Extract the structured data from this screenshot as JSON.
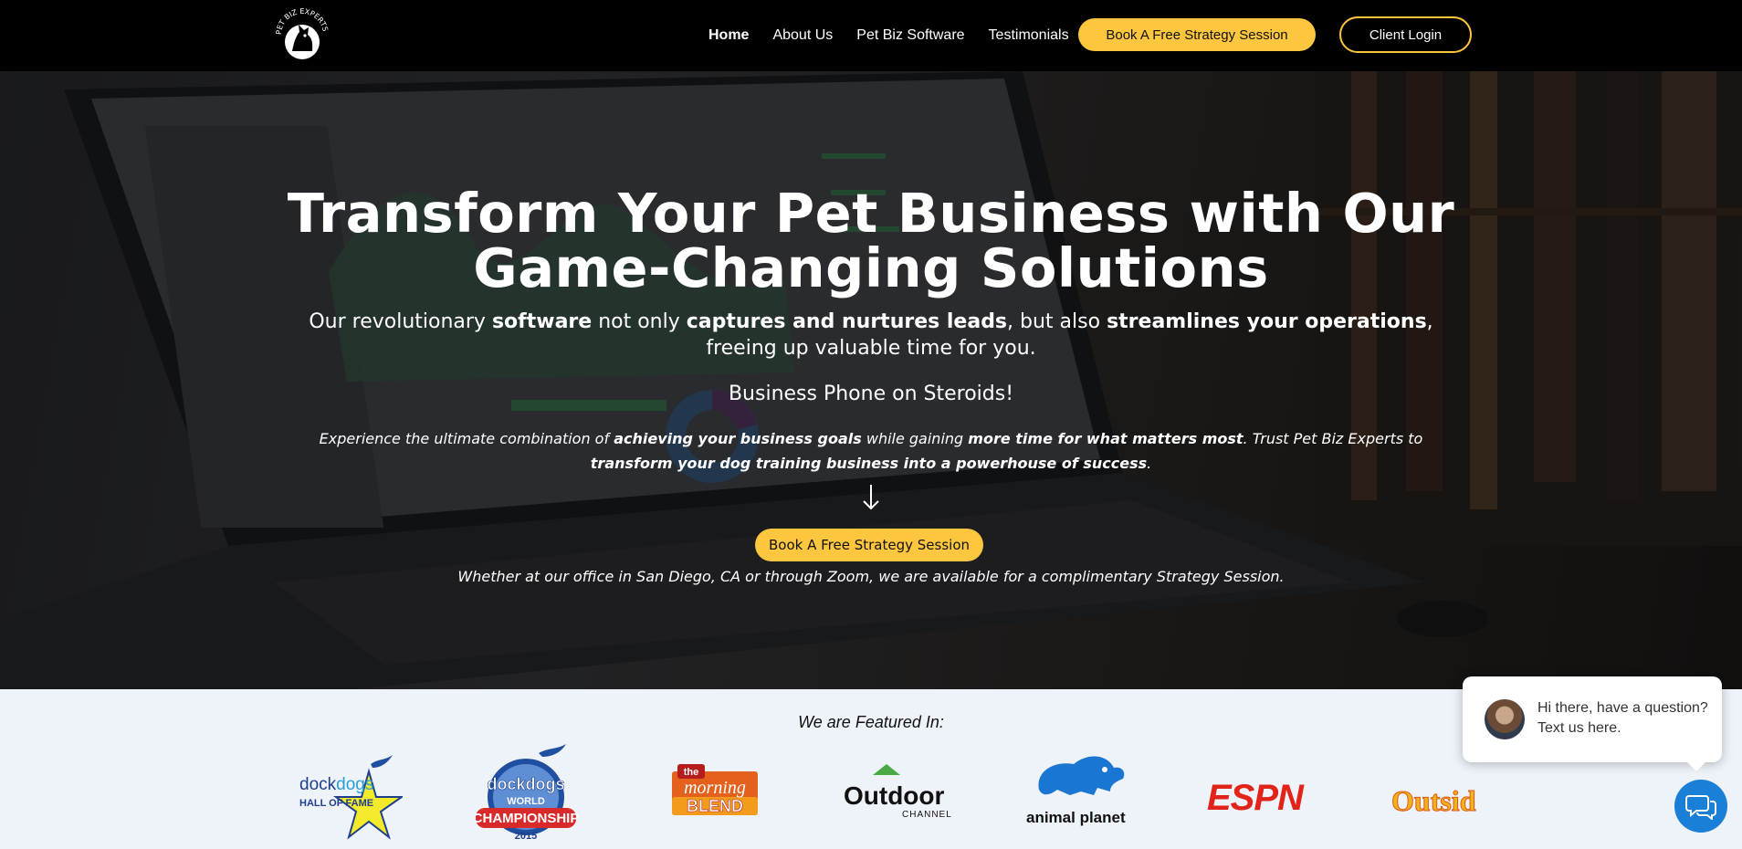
{
  "nav": {
    "logo_text": "PET BIZ EXPERTS",
    "links": [
      "Home",
      "About Us",
      "Pet Biz Software",
      "Testimonials"
    ],
    "cta": "Book A Free Strategy Session",
    "login": "Client Login"
  },
  "hero": {
    "title_line1": "Transform Your Pet Business with Our",
    "title_line2": "Game-Changing Solutions",
    "sub": {
      "p1": "Our revolutionary ",
      "b1": "software",
      "p2": " not only ",
      "b2": "captures and nurtures leads",
      "p3": ", but also ",
      "b3": "streamlines your operations",
      "p4": ", freeing up valuable time for you."
    },
    "phone_line": "Business Phone on Steroids!",
    "experience": {
      "p1": "Experience the ultimate combination of ",
      "b1": "achieving your business goals",
      "p2": " while gaining ",
      "b2": "more time for what matters most",
      "p3": ". Trust Pet Biz Experts to ",
      "b3": "transform your dog training business into a powerhouse of success",
      "p4": "."
    },
    "cta": "Book A Free Strategy Session",
    "note": "Whether at our office in San Diego, CA or through Zoom, we are available for a complimentary Strategy Session."
  },
  "featured": {
    "title": "We are Featured In:",
    "logos": {
      "dockdogs_hof": {
        "line1a": "dock",
        "line1b": "dogs",
        "line2": "HALL OF FAME"
      },
      "dockdogs_world": {
        "line1": "dockdogs",
        "line2": "WORLD",
        "line3": "CHAMPIONSHIP",
        "year": "2015"
      },
      "morning_blend": {
        "the": "the",
        "morning": "morning",
        "blend": "BLEND"
      },
      "outdoor": {
        "main": "Outdoor",
        "sub": "CHANNEL"
      },
      "animal_planet": {
        "text": "animal planet"
      },
      "espn": {
        "text": "ESPN"
      },
      "outside": {
        "text": "Outsid"
      }
    }
  },
  "chat": {
    "message": "Hi there, have a question? Text us here."
  },
  "colors": {
    "accent": "#fcc63e",
    "nav_bg": "#000000",
    "featured_bg": "#eef2f9",
    "chat_blue": "#1a7fd6"
  }
}
